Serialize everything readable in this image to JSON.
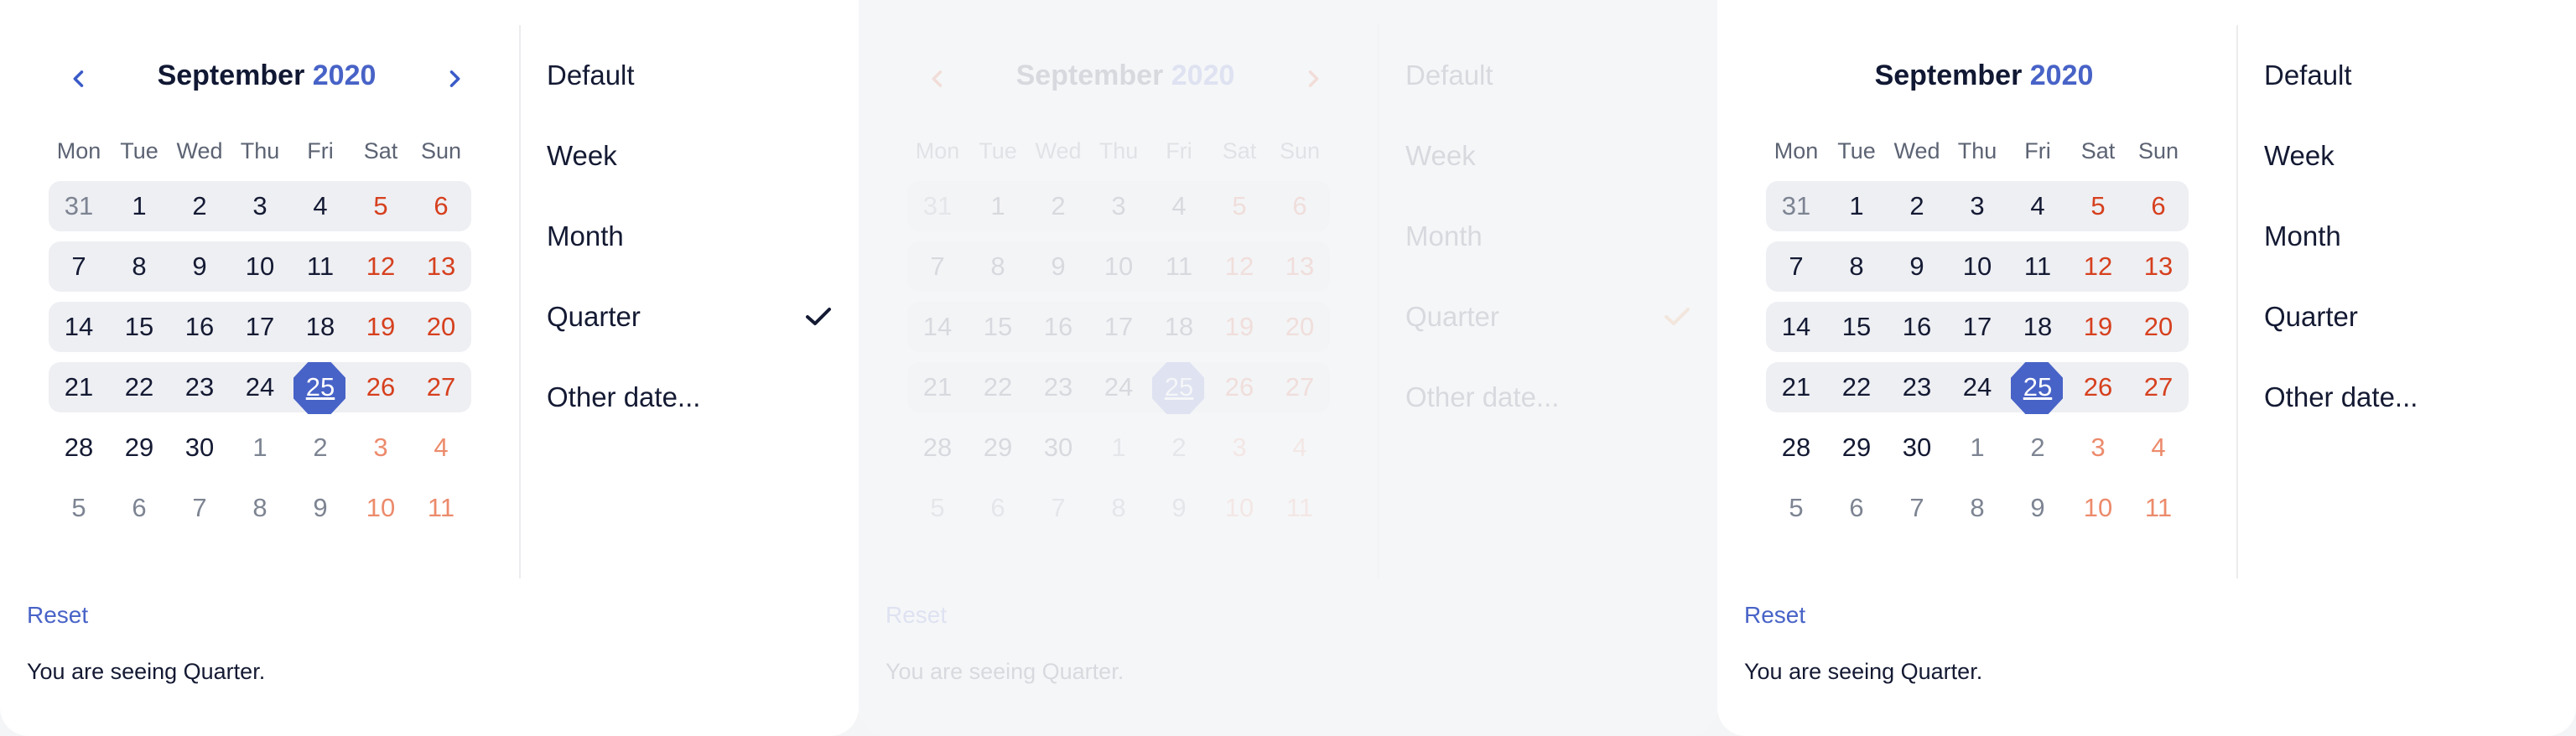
{
  "calendar": {
    "month_label": "September",
    "year_label": "2020",
    "weekday_labels": [
      "Mon",
      "Tue",
      "Wed",
      "Thu",
      "Fri",
      "Sat",
      "Sun"
    ],
    "weeks": [
      [
        "31",
        "1",
        "2",
        "3",
        "4",
        "5",
        "6"
      ],
      [
        "7",
        "8",
        "9",
        "10",
        "11",
        "12",
        "13"
      ],
      [
        "14",
        "15",
        "16",
        "17",
        "18",
        "19",
        "20"
      ],
      [
        "21",
        "22",
        "23",
        "24",
        "25",
        "26",
        "27"
      ],
      [
        "28",
        "29",
        "30",
        "1",
        "2",
        "3",
        "4"
      ],
      [
        "5",
        "6",
        "7",
        "8",
        "9",
        "10",
        "11"
      ]
    ],
    "selected_day": "25",
    "prev_icon": "chevron-left-icon",
    "next_icon": "chevron-right-icon"
  },
  "menu": {
    "items": [
      "Default",
      "Week",
      "Month",
      "Quarter",
      "Other date..."
    ],
    "selected_item": "Quarter",
    "check_icon": "checkmark-icon"
  },
  "footer": {
    "reset_label": "Reset",
    "status_text": "You are seeing Quarter."
  },
  "colors": {
    "accent": "#4863c7",
    "weekend": "#d6401e",
    "check_variant_2": "#e8832a",
    "nav_variant_2": "#e23a00"
  }
}
